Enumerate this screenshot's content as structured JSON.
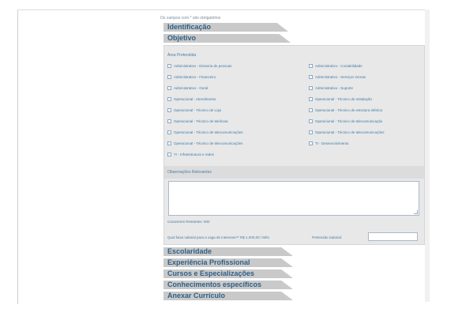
{
  "page": {
    "required_note": "Os campos com * são obrigatórios"
  },
  "sections": {
    "identificacao": "Identificação",
    "objetivo": "Objetivo",
    "escolaridade": "Escolaridade",
    "experiencia": "Experiência Profissional",
    "cursos": "Cursos e Especializações",
    "conhecimentos": "Conhecimentos específicos",
    "anexar": "Anexar Currículo"
  },
  "objetivo": {
    "area_title": "Área Pretendida",
    "checkboxes_left": [
      "Administrativo - Diretoria de pessoas",
      "Administrativo - Financeiro",
      "Administrativo - Geral",
      "Operacional - Atendimento",
      "Operacional - Técnico de Loja",
      "Operacional - Técnico de telefonia",
      "Operacional - Técnico de telecomunicações",
      "Operacional - Técnico de telecomunicações",
      "TI - Infraestrutura e redes"
    ],
    "checkboxes_right": [
      "Administrativo - Contabilidade",
      "Administrativo - Serviços Gerais",
      "Administrativo - Suporte",
      "Operacional - Técnico de Instalação",
      "Operacional - Técnico de estrutura elétrica",
      "Operacional - Técnico de telecomunicação",
      "Operacional - Técnico de telecomunicações",
      "TI - Desenvolvimento"
    ],
    "observacoes_title": "Observações Relevantes",
    "char_counter": "Caracteres Restantes: 500",
    "salary_question": "Qual faixa salarial para a vaga de interesse?* R$ 1.000,00 / Mês",
    "salary_label": "Pretensão Salarial:",
    "salary_value": ""
  }
}
